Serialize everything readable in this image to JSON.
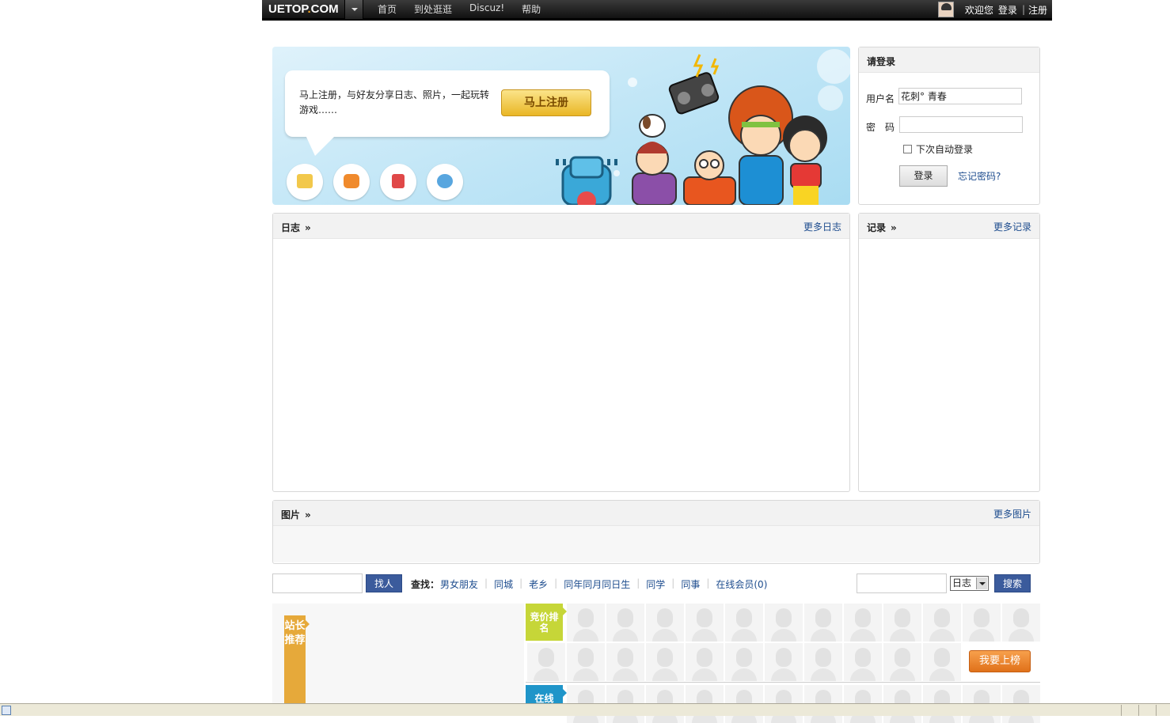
{
  "topbar": {
    "logo_main": "UETOP",
    "logo_dot": ".",
    "logo_suffix": "COM",
    "nav": [
      "首页",
      "到处逛逛",
      "Discuz!",
      "帮助"
    ],
    "welcome": "欢迎您",
    "login": "登录",
    "separator": "|",
    "register": "注册"
  },
  "banner": {
    "slogan": "马上注册，与好友分享日志、照片，一起玩转游戏……",
    "register_button": "马上注册",
    "feature_icons": [
      "log-icon",
      "camera-icon",
      "card-icon",
      "friends-icon"
    ]
  },
  "login_box": {
    "title": "请登录",
    "username_label": "用户名",
    "username_value": "花刺° 青春",
    "password_label": "密　码",
    "remember_label": "下次自动登录",
    "login_button": "登录",
    "forgot_link": "忘记密码?"
  },
  "blog": {
    "title": "日志",
    "arrow": "»",
    "more": "更多日志"
  },
  "records": {
    "title": "记录",
    "arrow": "»",
    "more": "更多记录"
  },
  "pictures": {
    "title": "图片",
    "arrow": "»",
    "more": "更多图片"
  },
  "search_bar": {
    "find_people_button": "找人",
    "find_label": "查找：",
    "links": [
      "男女朋友",
      "同城",
      "老乡",
      "同年同月同日生",
      "同学",
      "同事",
      "在线会员(0)"
    ],
    "type_select": "日志",
    "search_button": "搜索"
  },
  "bottom": {
    "recommend_tag": "站长推荐",
    "rank_tag": "竞价排名",
    "online_tag": "在线",
    "onlist_button": "我要上榜"
  },
  "colors": {
    "accent_blue": "#3b5b9c",
    "link_blue": "#1d4c8e",
    "register_gold": "#e9b625",
    "rank_green": "#c6d638",
    "online_blue": "#1f95c9",
    "recommend_orange": "#e6a93a"
  }
}
